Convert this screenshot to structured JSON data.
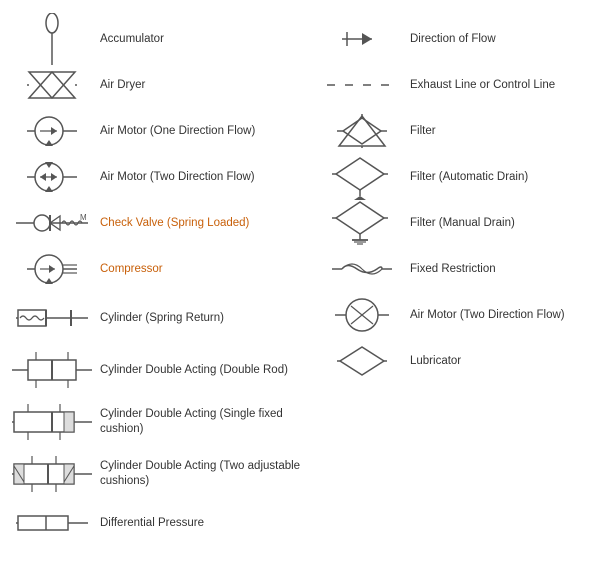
{
  "left_items": [
    {
      "id": "accumulator",
      "label": "Accumulator"
    },
    {
      "id": "air-dryer",
      "label": "Air Dryer"
    },
    {
      "id": "air-motor-one",
      "label": "Air Motor (One Direction Flow)"
    },
    {
      "id": "air-motor-two",
      "label": "Air Motor (Two Direction Flow)"
    },
    {
      "id": "check-valve",
      "label": "Check Valve (Spring Loaded)",
      "orange": true
    },
    {
      "id": "compressor",
      "label": "Compressor",
      "orange": true
    },
    {
      "id": "cylinder-spring",
      "label": "Cylinder (Spring Return)"
    },
    {
      "id": "cylinder-double-rod",
      "label": "Cylinder Double Acting (Double Rod)"
    },
    {
      "id": "cylinder-double-single",
      "label": "Cylinder Double Acting (Single fixed cushion)"
    },
    {
      "id": "cylinder-double-two",
      "label": "Cylinder Double Acting (Two adjustable cushions)"
    },
    {
      "id": "differential",
      "label": "Differential Pressure"
    }
  ],
  "right_items": [
    {
      "id": "direction-flow",
      "label": "Direction of Flow"
    },
    {
      "id": "exhaust-line",
      "label": "Exhaust Line or Control Line"
    },
    {
      "id": "filter",
      "label": "Filter"
    },
    {
      "id": "filter-auto",
      "label": "Filter (Automatic Drain)"
    },
    {
      "id": "filter-manual",
      "label": "Filter (Manual Drain)"
    },
    {
      "id": "fixed-restriction",
      "label": "Fixed Restriction"
    },
    {
      "id": "air-motor-two-right",
      "label": "Air Motor (Two Direction Flow)"
    },
    {
      "id": "lubricator",
      "label": "Lubricator"
    }
  ]
}
